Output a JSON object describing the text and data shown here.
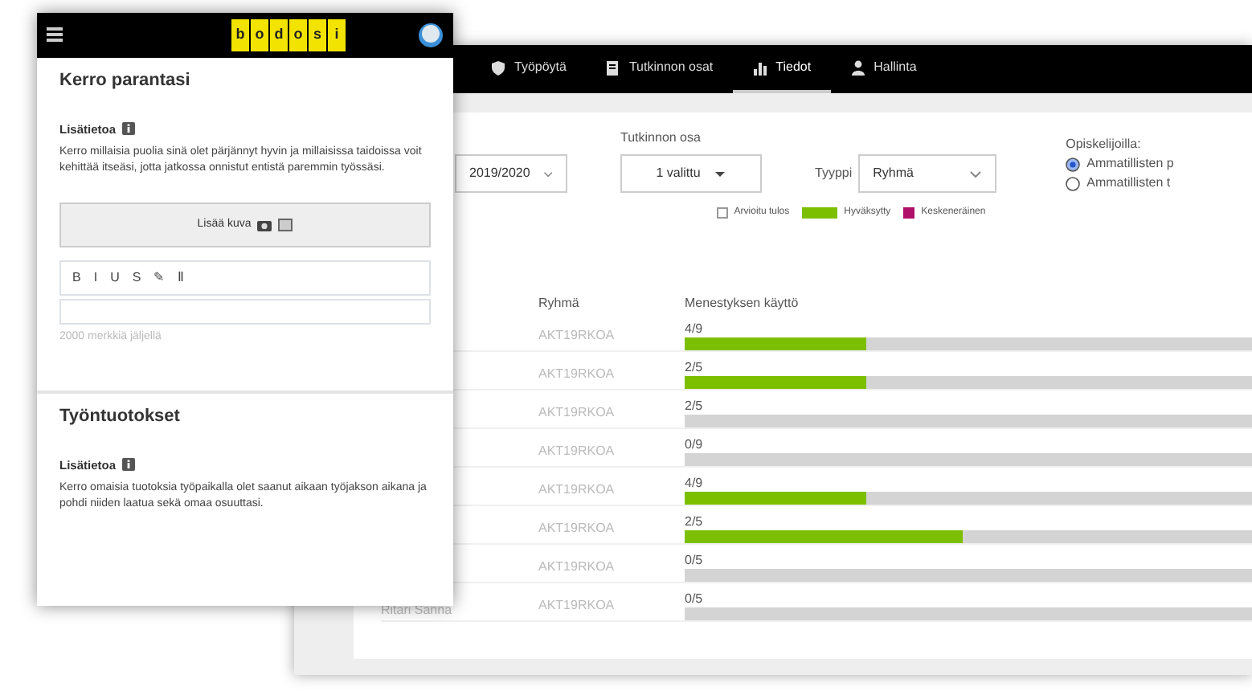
{
  "mobile": {
    "logo_letters": [
      "b",
      "o",
      "d",
      "o",
      "s",
      "i"
    ],
    "heading": "Kerro parantasi",
    "info_label": "Lisätietoa",
    "paragraph": "Kerro millaisia puolia sinä olet pärjännyt hyvin ja millaisissa taidoissa voit kehittää itseäsi, jotta jatkossa onnistut entistä paremmin työssäsi.",
    "upload_button": "Lisää kuva",
    "editor_tools": [
      "B",
      "I",
      "U",
      "S",
      "✎",
      "Ⅱ"
    ],
    "counter": "2000 merkkiä jäljellä",
    "heading_2": "Työntuotokset",
    "info_label_2": "Lisätietoa",
    "paragraph_2": "Kerro omaisia tuotoksia työpaikalla olet saanut aikaan työjakson aikana ja pohdi niiden laatua sekä omaa osuuttasi."
  },
  "desktop": {
    "tabs": [
      {
        "label": "Työpöytä",
        "selected": false
      },
      {
        "label": "Tutkinnon osat",
        "selected": false
      },
      {
        "label": "Tiedot",
        "selected": true
      },
      {
        "label": "Hallinta",
        "selected": false
      }
    ],
    "filters": {
      "year_value": "2019/2020",
      "part_label": "Tutkinnon osa",
      "part_value": "1 valittu",
      "type_label": "Tyyppi",
      "type_value": "Ryhmä",
      "students_label": "Opiskelijoilla:",
      "options": [
        {
          "label": "Ammatillisten p",
          "selected": true
        },
        {
          "label": "Ammatillisten t",
          "selected": false
        }
      ]
    },
    "legend": [
      {
        "label": "Arvioitu tulos",
        "kind": "outline"
      },
      {
        "label": "Hyväksytty",
        "kind": "fill",
        "color": "#7cbf00"
      },
      {
        "label": "Keskeneräinen",
        "kind": "fill",
        "color": "#b0106a"
      }
    ],
    "columns": [
      "Ryhmä",
      "Menestyksen käyttö"
    ],
    "rows": [
      {
        "group": "AKT19RKOA",
        "reading": "4/9",
        "level": 0.32
      },
      {
        "group": "AKT19RKOA",
        "reading": "2/5",
        "level": 0.32
      },
      {
        "group": "AKT19RKOA",
        "reading": "2/5",
        "level": 0
      },
      {
        "group": "AKT19RKOA",
        "reading": "0/9",
        "level": 0
      },
      {
        "group": "AKT19RKOA",
        "reading": "4/9",
        "level": 0.32
      },
      {
        "group": "AKT19RKOA",
        "reading": "2/5",
        "level": 0.49
      },
      {
        "group": "AKT19RKOA",
        "reading": "0/5",
        "level": 0
      },
      {
        "name": "Ritari Sanna",
        "group": "AKT19RKOA",
        "reading": "0/5",
        "level": 0
      }
    ]
  }
}
